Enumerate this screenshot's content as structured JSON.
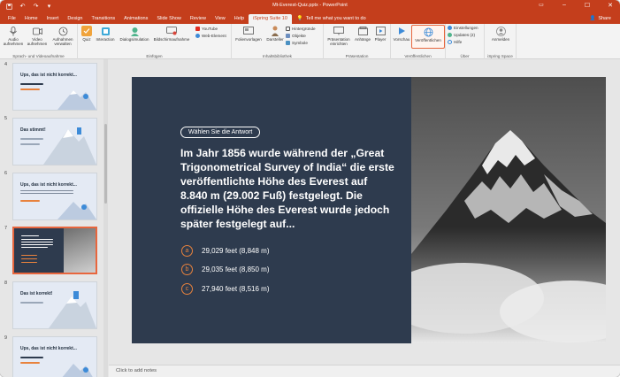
{
  "window": {
    "title": "Mt-Everest-Quiz.pptx  -  PowerPoint",
    "qat": [
      "save-icon",
      "undo-icon",
      "redo-icon",
      "customize-icon"
    ],
    "controls": [
      "ribbon-options-icon",
      "minimize-icon",
      "maximize-icon",
      "close-icon"
    ]
  },
  "tabs": [
    {
      "label": "File",
      "active": false
    },
    {
      "label": "Home",
      "active": false
    },
    {
      "label": "Insert",
      "active": false
    },
    {
      "label": "Design",
      "active": false
    },
    {
      "label": "Transitions",
      "active": false
    },
    {
      "label": "Animations",
      "active": false
    },
    {
      "label": "Slide Show",
      "active": false
    },
    {
      "label": "Review",
      "active": false
    },
    {
      "label": "View",
      "active": false
    },
    {
      "label": "Help",
      "active": false
    },
    {
      "label": "iSpring Suite 10",
      "active": true
    }
  ],
  "tellme": "Tell me what you want to do",
  "share": "Share",
  "ribbon": {
    "groups": {
      "sprach": "Sprach- und Videoaufnahme",
      "einfuegen": "Einfügen",
      "inhalt": "Inhaltsbibliothek",
      "praesentation": "Präsentation",
      "veroeffentlichen": "Veröffentlichen",
      "ueber": "Über",
      "ispring_space": "iSpring Space"
    },
    "buttons": {
      "audio": "Audio aufnehmen",
      "video": "Video aufnehmen",
      "aufnahmen": "Aufnahmen verwalten",
      "quiz": "Quiz",
      "interaction": "Interaction",
      "dialog": "Dialogsimulation",
      "bildschirm": "Bildschirmaufnahme",
      "youtube": "YouTube",
      "web": "Web-Element",
      "folien": "Folienvorlagen",
      "darsteller": "Darsteller",
      "hintergruende": "Hintergründe",
      "objekte": "Objekte",
      "symbole": "Symbole",
      "praesentation_einrichten": "Präsentation einrichten",
      "anhaenge": "Anhänge",
      "player": "Player",
      "vorschau": "Vorschau",
      "veroeffentlichen": "Veröffentlichen",
      "einstellungen": "Einstellungen",
      "updates": "Updates (2)",
      "hilfe": "Hilfe",
      "anmelden": "Anmelden"
    }
  },
  "thumbnails": [
    {
      "number": "4",
      "title": "Ups, das ist nicht korrekt...",
      "selected": false
    },
    {
      "number": "5",
      "title": "Das stimmt!",
      "selected": false
    },
    {
      "number": "6",
      "title": "Ups, das ist nicht korrekt...",
      "selected": false
    },
    {
      "number": "7",
      "title": "",
      "selected": true
    },
    {
      "number": "8",
      "title": "Das ist korrekt!",
      "selected": false
    },
    {
      "number": "9",
      "title": "Ups, das ist nicht korrekt...",
      "selected": false
    }
  ],
  "slide": {
    "pill": "Wählen Sie die Antwort",
    "question": "Im Jahr 1856 wurde während der „Great Trigonometrical Survey of India“ die erste veröffentlichte Höhe des Everest auf 8.840 m (29.002 Fuß) festgelegt. Die offizielle Höhe des Everest wurde jedoch später festgelegt auf...",
    "answers": [
      {
        "letter": "a",
        "text": "29,029 feet (8,848 m)"
      },
      {
        "letter": "b",
        "text": "29,035 feet (8,850 m)"
      },
      {
        "letter": "c",
        "text": "27,940 feet (8,516 m)"
      }
    ]
  },
  "notes": "Click to add notes",
  "colors": {
    "accent": "#c43e1c",
    "slide_dark": "#2e3b4e",
    "answer_orange": "#e8823d"
  }
}
